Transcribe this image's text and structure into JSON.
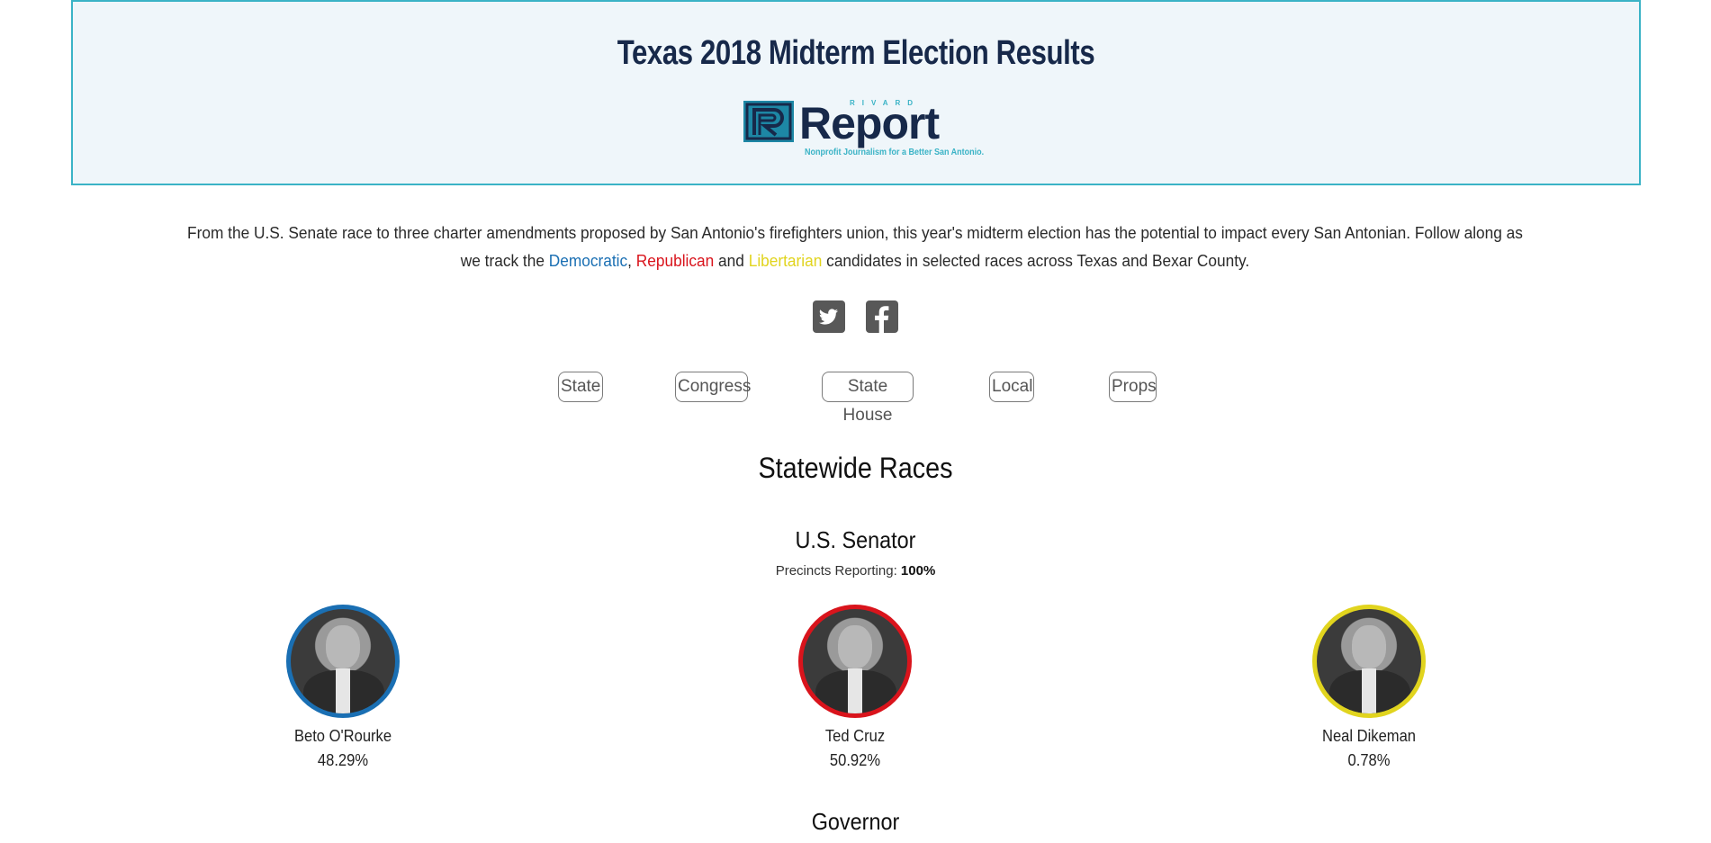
{
  "header": {
    "title": "Texas 2018 Midterm Election Results",
    "logo": {
      "small_text": "RIVARD",
      "word": "Report",
      "tagline": "Nonprofit Journalism for a Better San Antonio."
    }
  },
  "intro": {
    "text_before": "From the U.S. Senate race to three charter amendments proposed by San Antonio's firefighters union, this year's midterm election has the potential to impact every San Antonian. Follow along as we track the",
    "democratic": "Democratic",
    "comma": ",",
    "republican": "Republican",
    "and": "and",
    "libertarian": "Libertarian",
    "text_after": "candidates in selected races across Texas and Bexar County."
  },
  "social": {
    "icons": [
      "twitter-icon",
      "facebook-icon"
    ]
  },
  "nav": [
    {
      "label": "State"
    },
    {
      "label": "Congress"
    },
    {
      "label": "State House"
    },
    {
      "label": "Local"
    },
    {
      "label": "Props"
    }
  ],
  "section": {
    "title": "Statewide Races"
  },
  "races": [
    {
      "title": "U.S. Senator",
      "precincts_label": "Precincts Reporting:",
      "precincts_value": "100%",
      "candidates": [
        {
          "name": "Beto O'Rourke",
          "percent": "48.29%",
          "party_color": "#1a6fb3"
        },
        {
          "name": "Ted Cruz",
          "percent": "50.92%",
          "party_color": "#d9141c"
        },
        {
          "name": "Neal Dikeman",
          "percent": "0.78%",
          "party_color": "#e1d41e"
        }
      ]
    },
    {
      "title": "Governor"
    }
  ],
  "colors": {
    "header_border": "#3ab3c6",
    "header_bg": "#eff6fa",
    "title": "#17294a",
    "democratic": "#1a6fb3",
    "republican": "#d9141c",
    "libertarian": "#e1d41e"
  }
}
